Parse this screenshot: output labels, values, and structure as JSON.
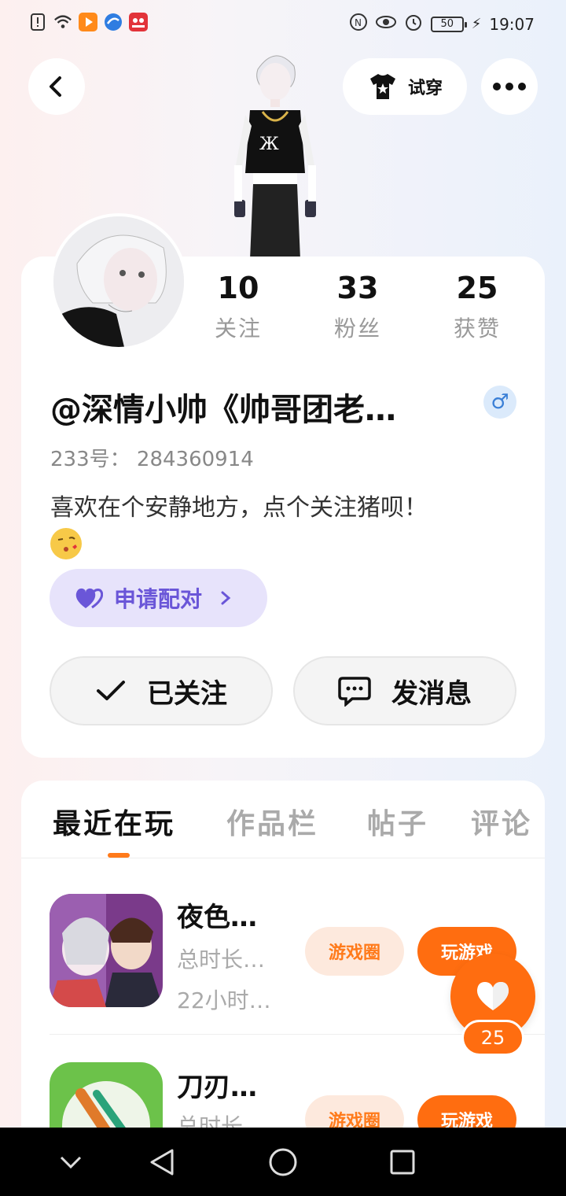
{
  "status_bar": {
    "time": "19:07",
    "battery": "50",
    "left_icons": [
      "alert-icon",
      "wifi-icon",
      "video-app-icon",
      "browser-app-icon",
      "camera-app-icon"
    ],
    "right_icons": [
      "nfc-icon",
      "eye-icon",
      "alarm-icon",
      "battery-icon",
      "charging-icon"
    ]
  },
  "top_bar": {
    "try_on_label": "试穿"
  },
  "profile": {
    "stats": [
      {
        "value": "10",
        "label": "关注"
      },
      {
        "value": "33",
        "label": "粉丝"
      },
      {
        "value": "25",
        "label": "获赞"
      }
    ],
    "username": "@深情小帅《帅哥团老…",
    "gender_symbol": "♂",
    "uid_label": "233号：",
    "uid_value": "284360914",
    "bio": "喜欢在个安静地方，点个关注猪呗！",
    "pair_button_label": "申请配对",
    "follow_button_label": "已关注",
    "message_button_label": "发消息"
  },
  "tabs": [
    {
      "label": "最近在玩",
      "active": true
    },
    {
      "label": "作品栏",
      "active": false
    },
    {
      "label": "帖子",
      "active": false
    },
    {
      "label": "评论",
      "active": false
    }
  ],
  "games": [
    {
      "title": "夜色…",
      "total_label": "总时长…",
      "duration": "22小时…",
      "circle_label": "游戏圈",
      "play_label": "玩游戏"
    },
    {
      "title": "刀刃…",
      "total_label": "总时长…",
      "circle_label": "游戏圈",
      "play_label": "玩游戏"
    }
  ],
  "like_fab": {
    "count": "25"
  },
  "colors": {
    "accent_orange": "#ff6d10",
    "pair_purple": "#6a56d8",
    "gender_blue": "#3a7fd6"
  }
}
